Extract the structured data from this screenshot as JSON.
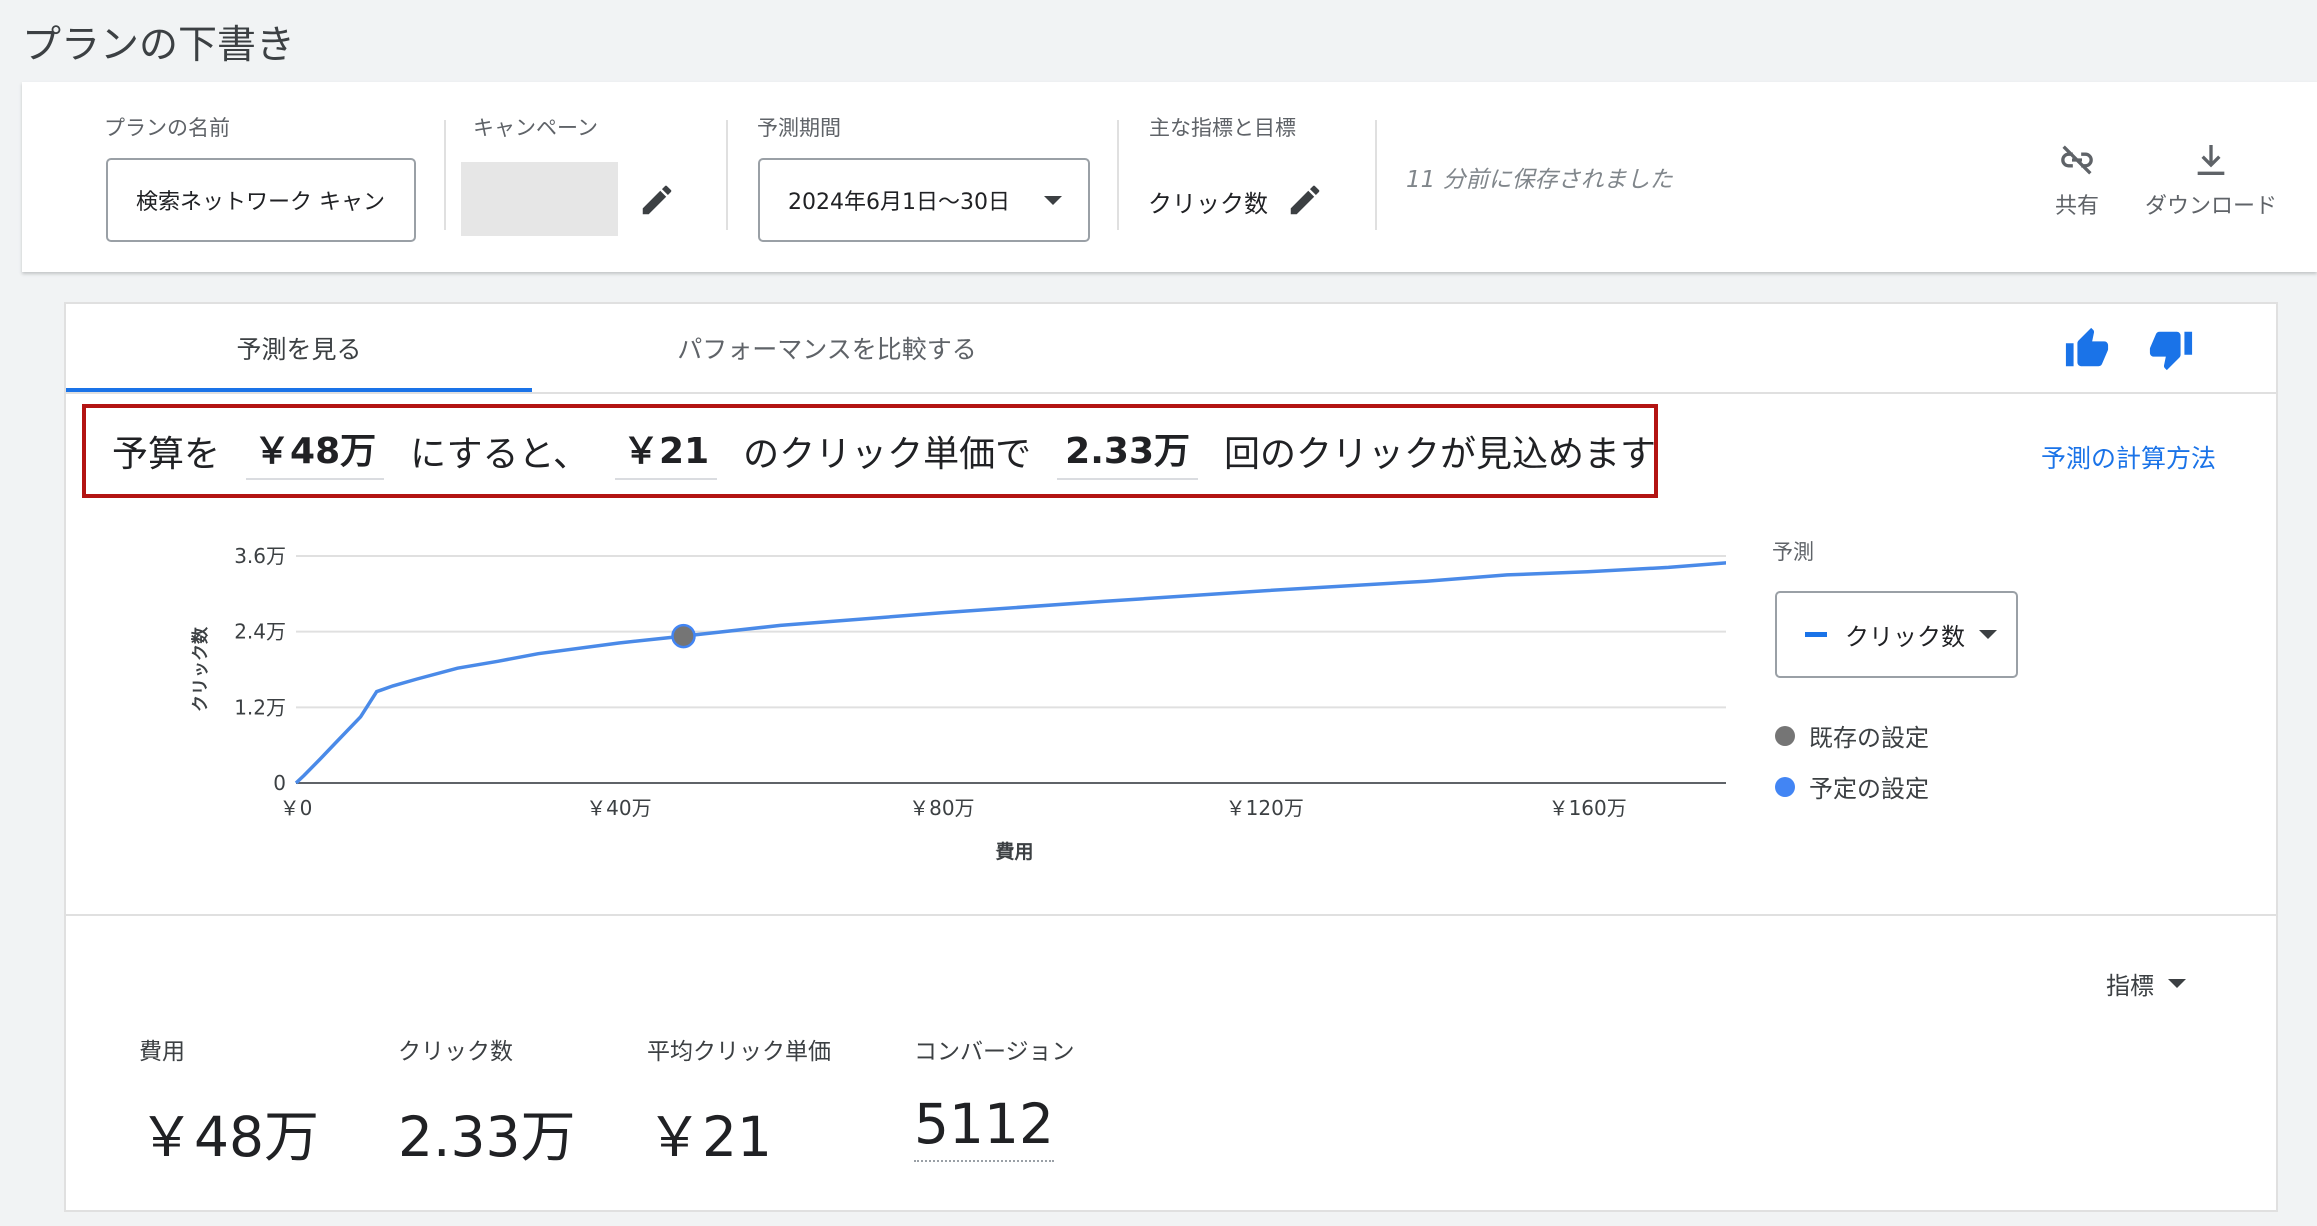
{
  "page_title": "プランの下書き",
  "header": {
    "plan_name_label": "プランの名前",
    "plan_name_value": "検索ネットワーク キャン",
    "campaign_label": "キャンペーン",
    "period_label": "予測期間",
    "period_value": "2024年6月1日〜30日",
    "metrics_label": "主な指標と目標",
    "metrics_value": "クリック数",
    "saved_text": "11 分前に保存されました",
    "share_label": "共有",
    "download_label": "ダウンロード"
  },
  "tabs": [
    {
      "label": "予測を見る",
      "active": true
    },
    {
      "label": "パフォーマンスを比較する",
      "active": false
    }
  ],
  "summary": {
    "p1": "予算を",
    "budget": "￥48万",
    "p2": "にすると、",
    "cpc": "￥21",
    "p3": "のクリック単価で",
    "clicks": "2.33万",
    "p4": "回のクリックが見込めます"
  },
  "calc_link": "予測の計算方法",
  "legend": {
    "title": "予測",
    "metric_select": "クリック数",
    "existing": "既存の設定",
    "planned": "予定の設定"
  },
  "colors": {
    "accent": "#1a73e8",
    "line": "#4a8ae8",
    "existing_dot": "#757575",
    "planned_dot": "#4285f4",
    "highlight_border": "#b31412"
  },
  "chart_data": {
    "type": "line",
    "xlabel": "費用",
    "ylabel": "クリック数",
    "xlim": [
      0,
      178
    ],
    "ylim": [
      0,
      3.6
    ],
    "x_ticks": [
      0,
      40,
      80,
      120,
      160
    ],
    "x_tick_labels": [
      "￥0",
      "￥40万",
      "￥80万",
      "￥120万",
      "￥160万"
    ],
    "y_ticks": [
      0,
      1.2,
      2.4,
      3.6
    ],
    "y_tick_labels": [
      "0",
      "1.2万",
      "2.4万",
      "3.6万"
    ],
    "grid": true,
    "series": [
      {
        "x": [
          0,
          1,
          3,
          5,
          8,
          10,
          12,
          15,
          20,
          25,
          30,
          40,
          48,
          60,
          80,
          100,
          120,
          140,
          150,
          160,
          170,
          178
        ],
        "y": [
          0,
          0.12,
          0.38,
          0.65,
          1.05,
          1.45,
          1.54,
          1.65,
          1.82,
          1.93,
          2.05,
          2.22,
          2.33,
          2.5,
          2.7,
          2.88,
          3.05,
          3.2,
          3.3,
          3.35,
          3.42,
          3.5
        ]
      }
    ],
    "marker": {
      "x": 48,
      "y": 2.33
    }
  },
  "metrics_menu": "指標",
  "stats": [
    {
      "label": "費用",
      "value": "￥48万"
    },
    {
      "label": "クリック数",
      "value": "2.33万"
    },
    {
      "label": "平均クリック単価",
      "value": "￥21"
    },
    {
      "label": "コンバージョン",
      "value": "5112"
    }
  ]
}
